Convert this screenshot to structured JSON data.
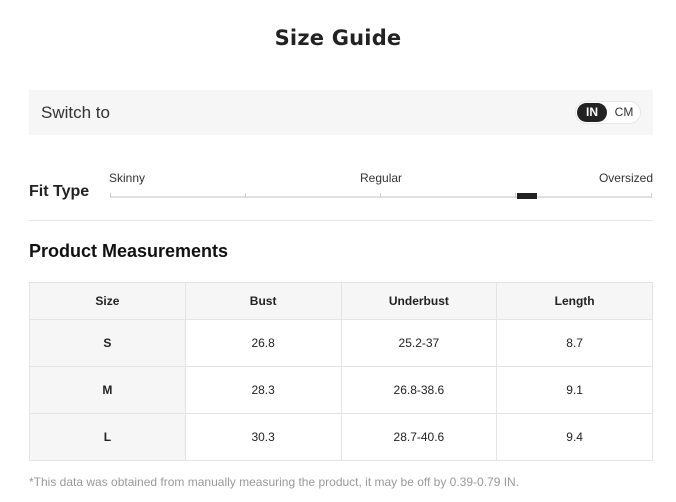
{
  "title": "Size Guide",
  "switch": {
    "label": "Switch to",
    "options": [
      "IN",
      "CM"
    ],
    "selected": "IN"
  },
  "fit": {
    "label": "Fit Type",
    "scale": [
      "Skinny",
      "Regular",
      "Oversized"
    ],
    "selected_position": 0.75
  },
  "measurements": {
    "title": "Product Measurements",
    "columns": [
      "Size",
      "Bust",
      "Underbust",
      "Length"
    ],
    "rows": [
      [
        "S",
        "26.8",
        "25.2-37",
        "8.7"
      ],
      [
        "M",
        "28.3",
        "26.8-38.6",
        "9.1"
      ],
      [
        "L",
        "30.3",
        "28.7-40.6",
        "9.4"
      ]
    ]
  },
  "footnote": "*This data was obtained from manually measuring the product, it may be off by 0.39-0.79 IN.",
  "colors": {
    "accent": "#222222",
    "panel_bg": "#f6f6f6",
    "muted_text": "#999999"
  }
}
